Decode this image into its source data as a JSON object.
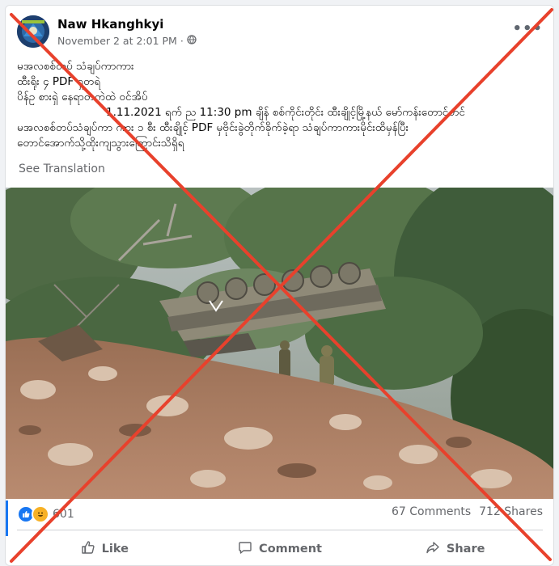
{
  "post": {
    "author": "Naw Hkanghkyi",
    "timestamp": "November 2 at 2:01 PM",
    "separator": "·",
    "more_label": "•••",
    "text_lines": [
      "မအလစစ်တပ် သံချပ်ကာကား",
      "ထီးရိုး ၄ PDF ရှတရဲ",
      "ပိန်ဥ စားရှဲ နေရာတကဲထဲ ဝင်အိပ်",
      "1.11.2021 ရက် ည 11:30 pm ချိန် စစ်ကိုင်းတိုင်း ထီးချိုင့်မြို့နယ် မော်ကန်းတောင်တင်",
      "မအလစစ်တပ်သံချပ်ကာ ကား ၁ စီး ထီးချိုင့် PDF မှဗိုင်းခွဲတိုက်ခိုက်ခဲ့ရာ သံချပ်ကာကားမိုင်းထိမှန်ပြီး",
      "တောင်အောက်သို့ထိုးကျသွားကြောင်းသိရှိရ"
    ],
    "see_translation": "See Translation"
  },
  "stats": {
    "reaction_count": "601",
    "comments": "67 Comments",
    "shares": "712 Shares"
  },
  "actions": {
    "like": "Like",
    "comment": "Comment",
    "share": "Share"
  },
  "colors": {
    "x_mark": "#e8412c",
    "link_blue": "#1877f2",
    "secondary_text": "#65676b"
  },
  "icons": [
    "globe-icon",
    "more-icon",
    "like-reaction-icon",
    "haha-reaction-icon",
    "like-icon",
    "comment-icon",
    "share-icon"
  ]
}
